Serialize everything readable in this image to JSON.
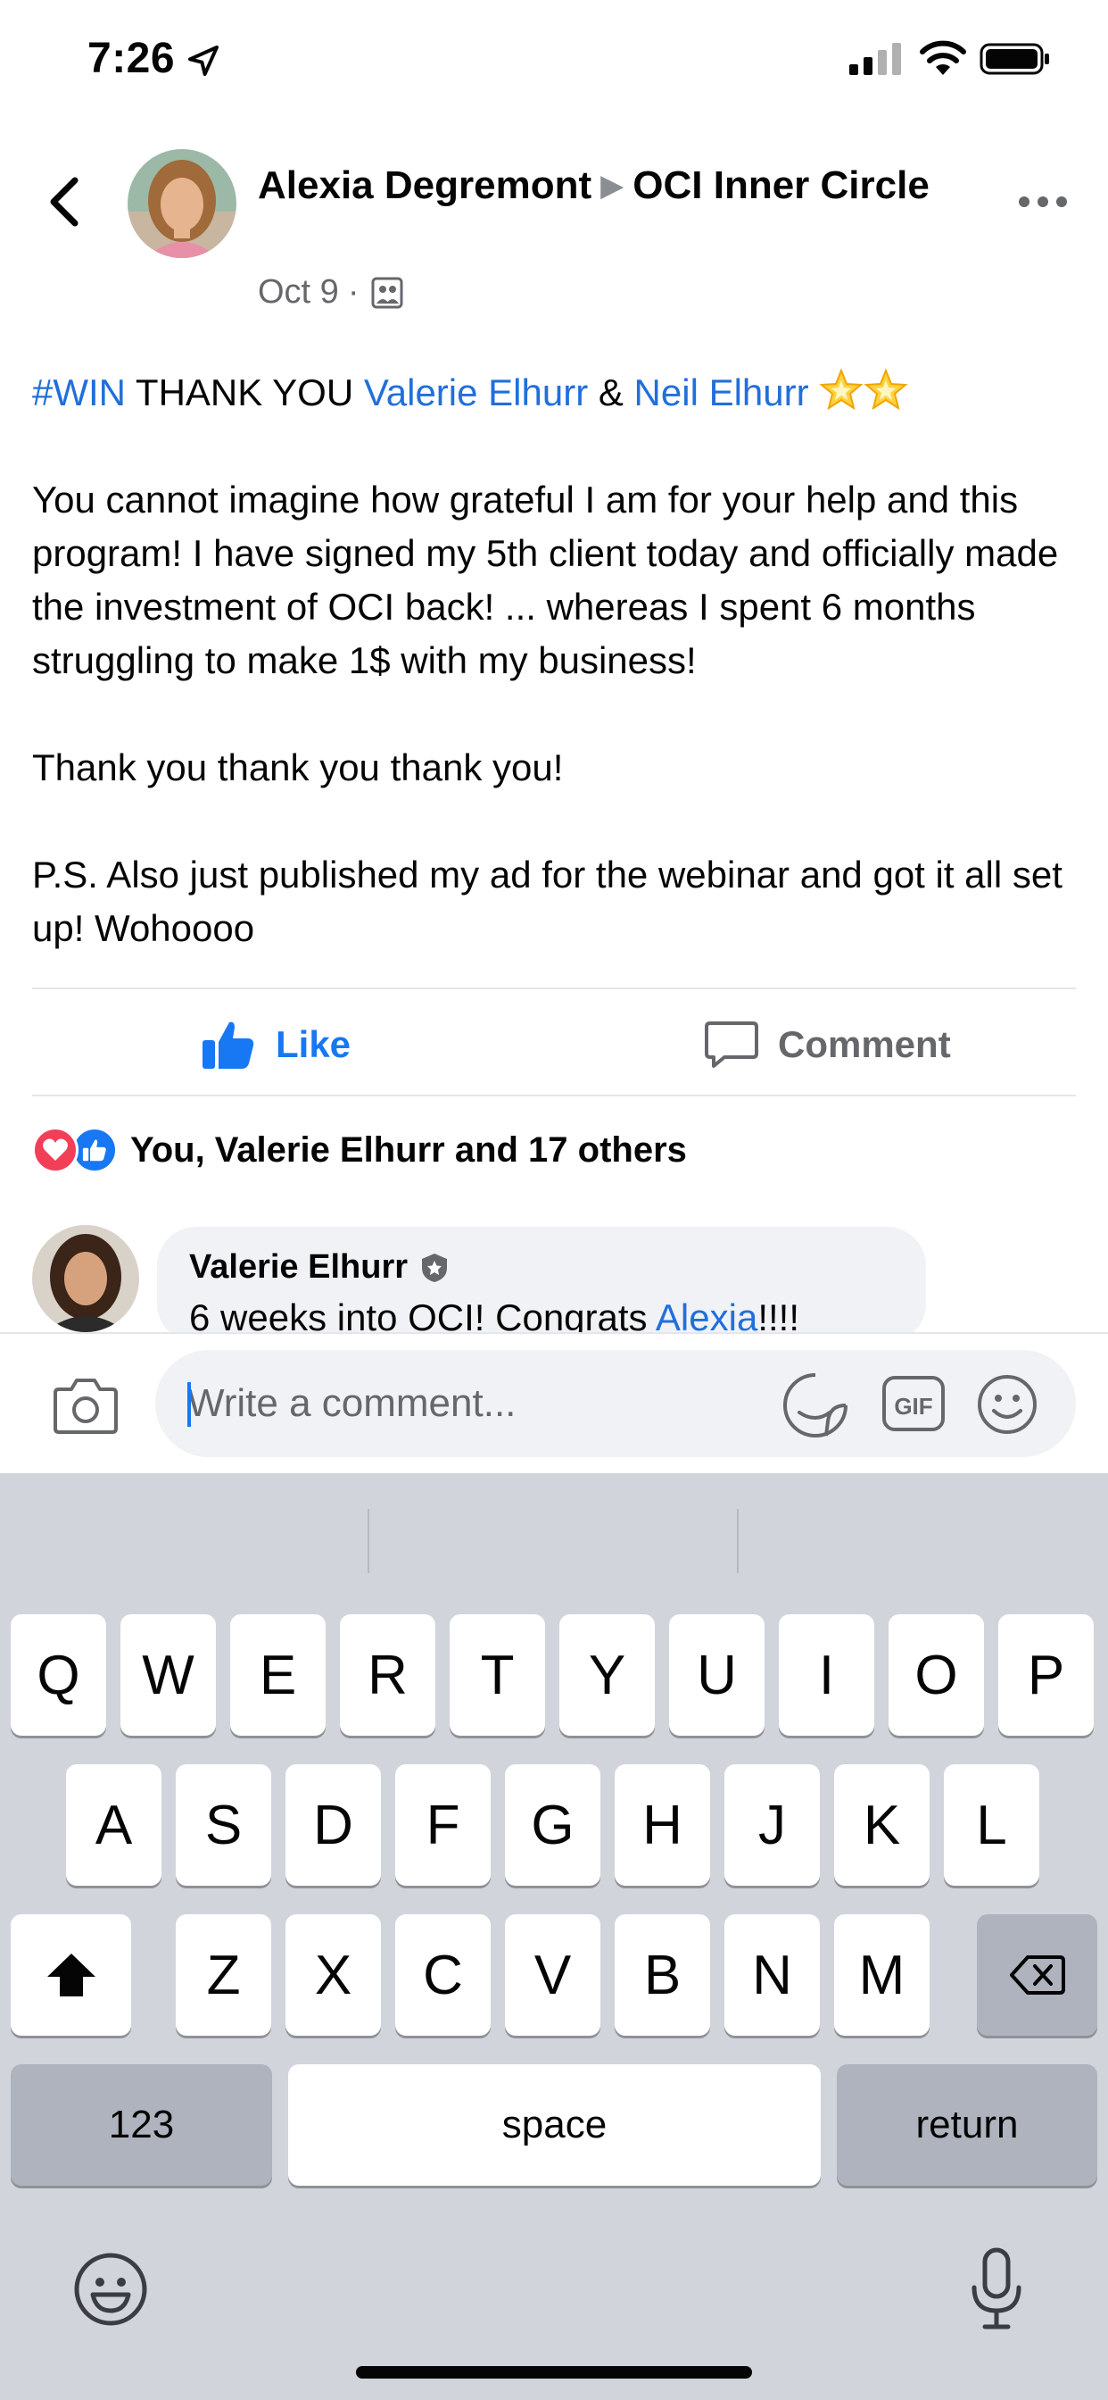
{
  "status_bar": {
    "time": "7:26"
  },
  "header": {
    "author": "Alexia Degremont",
    "arrow": "▶",
    "group": "OCI Inner Circle",
    "date": "Oct 9",
    "separator": "·"
  },
  "post": {
    "line1": {
      "hashtag": "#WIN",
      "text": " THANK YOU ",
      "mention1": "Valerie Elhurr",
      "amp": " & ",
      "mention2": "Neil Elhurr"
    },
    "paragraph2": "You cannot imagine how grateful I am for your help and this program! I have signed my 5th client today and officially made the investment of OCI back! ... whereas I spent 6 months struggling to make 1$ with my business!",
    "paragraph3": "Thank you thank you thank you!",
    "paragraph4": "P.S. Also just published my ad for the webinar and got it all set up! Wohoooo"
  },
  "actions": {
    "like": "Like",
    "comment": "Comment"
  },
  "reactions": {
    "text": "You, Valerie Elhurr and 17 others"
  },
  "comment": {
    "author": "Valerie Elhurr",
    "text_before": "6 weeks into OCI! Congrats ",
    "mention": "Alexia",
    "text_after": "!!!!"
  },
  "composer": {
    "placeholder": "Write a comment..."
  },
  "keyboard": {
    "row1": [
      "Q",
      "W",
      "E",
      "R",
      "T",
      "Y",
      "U",
      "I",
      "O",
      "P"
    ],
    "row2": [
      "A",
      "S",
      "D",
      "F",
      "G",
      "H",
      "J",
      "K",
      "L"
    ],
    "row3": [
      "Z",
      "X",
      "C",
      "V",
      "B",
      "N",
      "M"
    ],
    "numbers": "123",
    "space": "space",
    "return": "return"
  },
  "colors": {
    "link": "#216fdb",
    "brand_blue": "#1877f2",
    "secondary_text": "#65676b",
    "keyboard_bg": "#d1d4db"
  }
}
